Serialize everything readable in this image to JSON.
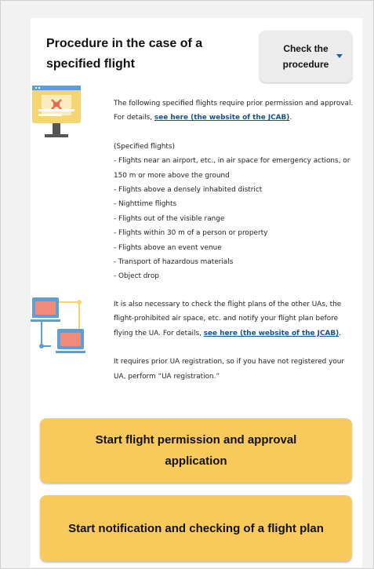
{
  "section": {
    "title": "Procedure in the case of a specified flight",
    "check_button_label": "Check the procedure"
  },
  "intro": {
    "text_before_link": "The following specified flights require prior permission and approval. For details, ",
    "link_label": "see here (the website of the JCAB)",
    "text_after_link": "."
  },
  "specified_flights": {
    "heading": "(Specified flights)",
    "items": [
      "- Flights near an airport, etc., in air space for emergency actions, or 150 m or more above the ground",
      "- Flights above a densely inhabited district",
      "- Nighttime flights",
      "- Flights out of the visible range",
      "- Flights within 30 m of a person or property",
      "- Flights above an event venue",
      "- Transport of hazardous materials",
      "- Object drop"
    ]
  },
  "flight_plan_note": {
    "text_before_link": "It is also necessary to check the flight plans of the other UAs, the flight-prohibited air space, etc. and notify your flight plan before flying the UA. For details, ",
    "link_label": "see here (the website of the JCAB)",
    "text_after_link": "."
  },
  "registration_note": "It requires prior UA registration, so if you have not registered your UA, perform “UA registration.”",
  "buttons": {
    "permission_label": "Start flight permission and approval application",
    "notification_label": "Start notification and checking of a flight plan"
  },
  "icons": {
    "monitor": "monitor-with-drone-icon",
    "network": "linked-computers-icon",
    "caret": "caret-down-icon"
  },
  "colors": {
    "accent_button": "#f8c95b",
    "link": "#1a4f8d",
    "caret": "#1d5ea8",
    "icon_blue": "#5aa0d8",
    "icon_yellow": "#f5d472"
  }
}
